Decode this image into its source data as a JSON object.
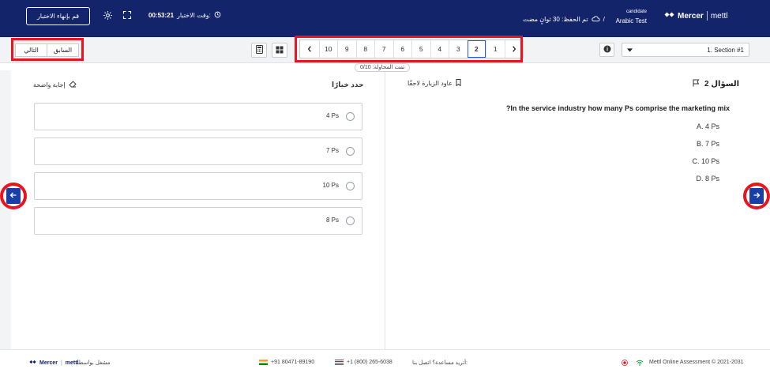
{
  "header": {
    "end_test_label": "قم بإنهاء الاختبار",
    "timer_label": "وقت الاختبار:",
    "timer_value": "00:53:21",
    "save_status": "تم الحفظ: 30 ثوانٍ مضت",
    "candidate_role": "candidate",
    "test_name": "Arabic Test",
    "breadcrumb_sep": "/",
    "logo_text": "Mercer",
    "logo_sub": "mettl"
  },
  "toolbar": {
    "prev_label": "السابق",
    "next_label": "التالي",
    "pages": [
      "10",
      "9",
      "8",
      "7",
      "6",
      "5",
      "4",
      "3",
      "2",
      "1"
    ],
    "active_page": "2",
    "section_label": "1. Section #1",
    "attempted_text": "تمت المحاولة: 0/10"
  },
  "answer_panel": {
    "choose_label": "حدد خيارًا",
    "clear_label": "إجابة واضحة",
    "options": [
      "4 Ps",
      "7 Ps",
      "10 Ps",
      "8 Ps"
    ]
  },
  "question_panel": {
    "question_label": "السؤال 2",
    "revisit_label": "عاود الزيارة لاحقًا",
    "question_text": "In the service industry how many Ps comprise the marketing mix?",
    "choices": [
      "A. 4 Ps",
      "B. 7 Ps",
      "C. 10 Ps",
      "D. 8 Ps"
    ]
  },
  "footer": {
    "copyright": "Mettl Online Assessment © 2021-2031",
    "help_text": "أتريد مساعدة؟ اتصل بنا:",
    "us_phone": "+1 (800) 265-6038",
    "in_phone": "+91 80471-89190",
    "powered_by": "مشغل بواسطة",
    "logo_text": "Mercer",
    "logo_sub": "mettl"
  },
  "colors": {
    "header_bg": "#14246b",
    "accent": "#1a3ea8",
    "highlight_red": "#e8141e"
  }
}
